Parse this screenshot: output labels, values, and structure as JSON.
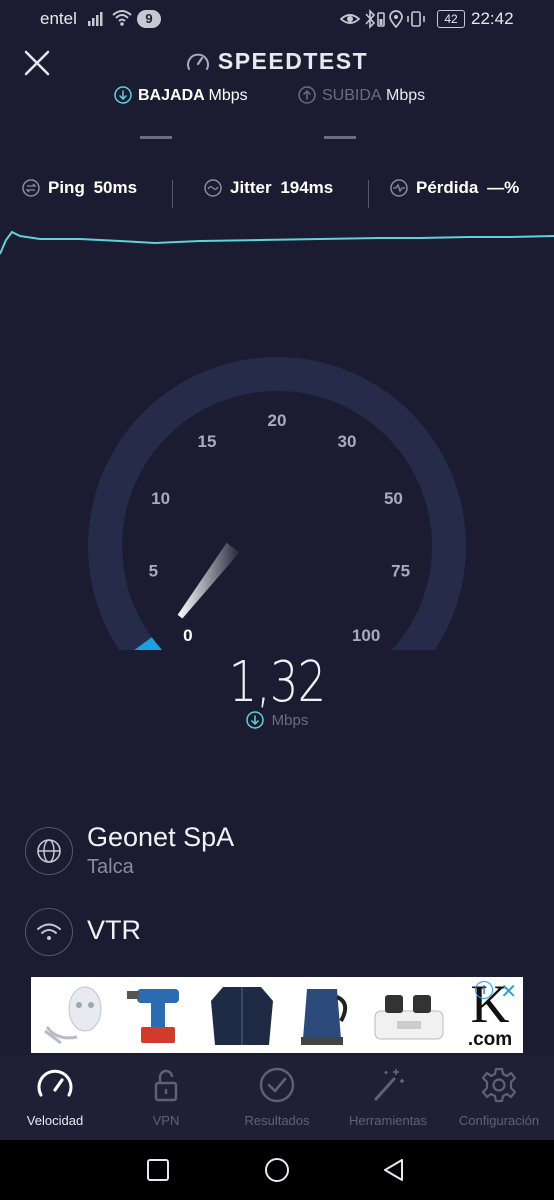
{
  "status_bar": {
    "carrier": "entel",
    "notification_count": "9",
    "battery": "42",
    "time": "22:42"
  },
  "header": {
    "title": "SPEEDTEST"
  },
  "direction": {
    "download_label": "BAJADA",
    "download_unit": "Mbps",
    "upload_label": "SUBIDA",
    "upload_unit": "Mbps"
  },
  "metrics": {
    "ping_label": "Ping",
    "ping_value": "50ms",
    "jitter_label": "Jitter",
    "jitter_value": "194ms",
    "loss_label": "Pérdida",
    "loss_value": "—%"
  },
  "gauge": {
    "tick_labels": [
      "0",
      "5",
      "10",
      "15",
      "20",
      "30",
      "50",
      "75",
      "100"
    ],
    "current_speed": "1,32",
    "unit": "Mbps",
    "needle_value": 1.32,
    "accent": "#1ba0e2"
  },
  "server": {
    "provider": "Geonet SpA",
    "location": "Talca",
    "isp": "VTR"
  },
  "ad": {
    "logo_text": "K",
    "logo_suffix": ".com",
    "info_icon": "i",
    "close_icon": "✕"
  },
  "nav": {
    "items": [
      {
        "label": "Velocidad",
        "icon": "speedometer-icon"
      },
      {
        "label": "VPN",
        "icon": "lock-icon"
      },
      {
        "label": "Resultados",
        "icon": "check-circle-icon"
      },
      {
        "label": "Herramientas",
        "icon": "magic-wand-icon"
      },
      {
        "label": "Configuración",
        "icon": "gear-icon"
      }
    ]
  },
  "colors": {
    "background": "#1b1c31",
    "accent": "#1ba0e2",
    "graph": "#5fd3dc",
    "muted": "#6a6c82"
  }
}
